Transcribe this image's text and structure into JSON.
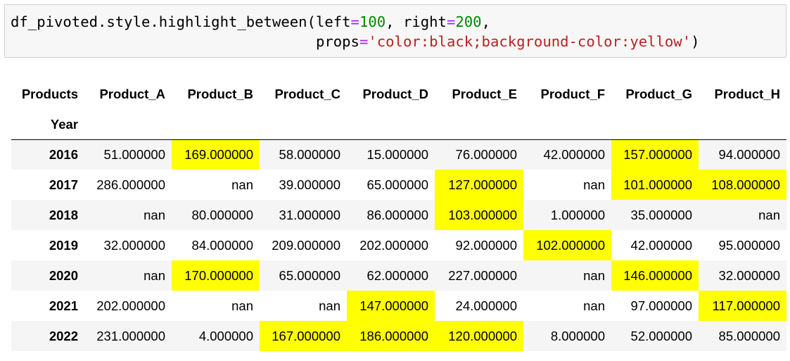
{
  "code_cell": {
    "line1": {
      "prefix": "df_pivoted.style.highlight_between(left",
      "eq1": "=",
      "num1": "100",
      "mid": ", right",
      "eq2": "=",
      "num2": "200",
      "suffix": ","
    },
    "line2": {
      "indent": "                                   ",
      "kw": "props",
      "eq": "=",
      "str": "'color:black;background-color:yellow'",
      "suffix": ")"
    }
  },
  "table": {
    "columns_axis_name": "Products",
    "index_name": "Year",
    "columns": [
      "Product_A",
      "Product_B",
      "Product_C",
      "Product_D",
      "Product_E",
      "Product_F",
      "Product_G",
      "Product_H"
    ],
    "highlight_color": "#ffff00",
    "rows": [
      {
        "year": "2016",
        "values": [
          "51.000000",
          "169.000000",
          "58.000000",
          "15.000000",
          "76.000000",
          "42.000000",
          "157.000000",
          "94.000000"
        ],
        "highlight": [
          false,
          true,
          false,
          false,
          false,
          false,
          true,
          false
        ]
      },
      {
        "year": "2017",
        "values": [
          "286.000000",
          "nan",
          "39.000000",
          "65.000000",
          "127.000000",
          "nan",
          "101.000000",
          "108.000000"
        ],
        "highlight": [
          false,
          false,
          false,
          false,
          true,
          false,
          true,
          true
        ]
      },
      {
        "year": "2018",
        "values": [
          "nan",
          "80.000000",
          "31.000000",
          "86.000000",
          "103.000000",
          "1.000000",
          "35.000000",
          "nan"
        ],
        "highlight": [
          false,
          false,
          false,
          false,
          true,
          false,
          false,
          false
        ]
      },
      {
        "year": "2019",
        "values": [
          "32.000000",
          "84.000000",
          "209.000000",
          "202.000000",
          "92.000000",
          "102.000000",
          "42.000000",
          "95.000000"
        ],
        "highlight": [
          false,
          false,
          false,
          false,
          false,
          true,
          false,
          false
        ]
      },
      {
        "year": "2020",
        "values": [
          "nan",
          "170.000000",
          "65.000000",
          "62.000000",
          "227.000000",
          "nan",
          "146.000000",
          "32.000000"
        ],
        "highlight": [
          false,
          true,
          false,
          false,
          false,
          false,
          true,
          false
        ]
      },
      {
        "year": "2021",
        "values": [
          "202.000000",
          "nan",
          "nan",
          "147.000000",
          "24.000000",
          "nan",
          "97.000000",
          "117.000000"
        ],
        "highlight": [
          false,
          false,
          false,
          true,
          false,
          false,
          false,
          true
        ]
      },
      {
        "year": "2022",
        "values": [
          "231.000000",
          "4.000000",
          "167.000000",
          "186.000000",
          "120.000000",
          "8.000000",
          "52.000000",
          "85.000000"
        ],
        "highlight": [
          false,
          false,
          true,
          true,
          true,
          false,
          false,
          false
        ]
      }
    ]
  }
}
